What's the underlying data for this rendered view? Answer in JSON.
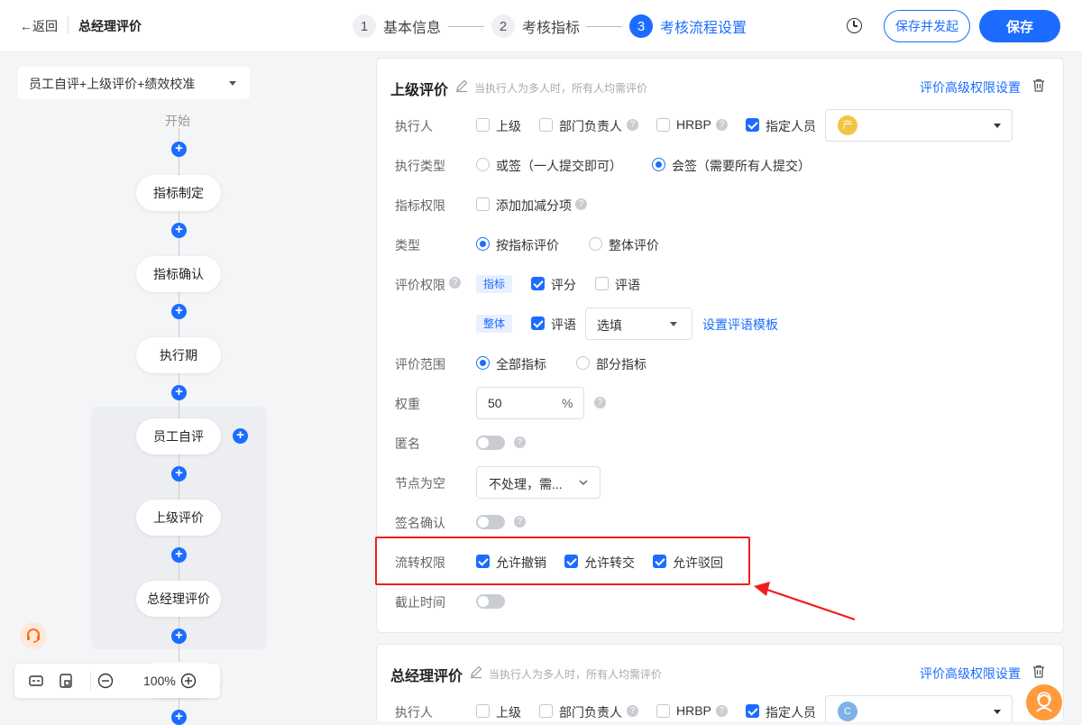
{
  "header": {
    "back_label": "←返回",
    "page_title": "总经理评价",
    "steps": [
      {
        "num": "1",
        "label": "基本信息"
      },
      {
        "num": "2",
        "label": "考核指标"
      },
      {
        "num": "3",
        "label": "考核流程设置"
      }
    ],
    "save_and_start_label": "保存并发起",
    "save_label": "保存"
  },
  "flow": {
    "template_select": "员工自评+上级评价+绩效校准",
    "start_label": "开始",
    "nodes": [
      "指标制定",
      "指标确认",
      "执行期",
      "员工自评",
      "上级评价",
      "总经理评价"
    ],
    "zoom_level": "100%"
  },
  "card1": {
    "title": "上级评价",
    "hint": "当执行人为多人时，所有人均需评价",
    "adv_settings": "评价高级权限设置",
    "executor": {
      "label": "执行人",
      "options": [
        "上级",
        "部门负责人",
        "HRBP",
        "指定人员"
      ],
      "avatar_text": "产"
    },
    "exec_type": {
      "label": "执行类型",
      "options": [
        "或签（一人提交即可）",
        "会签（需要所有人提交）"
      ]
    },
    "metric_perm": {
      "label": "指标权限",
      "option": "添加加减分项"
    },
    "type": {
      "label": "类型",
      "options": [
        "按指标评价",
        "整体评价"
      ]
    },
    "eval_perm": {
      "label": "评价权限",
      "tag_metric": "指标",
      "tag_overall": "整体",
      "score": "评分",
      "comment": "评语",
      "comment2": "评语",
      "comment_select": "选填",
      "template_link": "设置评语模板"
    },
    "scope": {
      "label": "评价范围",
      "options": [
        "全部指标",
        "部分指标"
      ]
    },
    "weight": {
      "label": "权重",
      "value": "50",
      "unit": "%"
    },
    "anonymous_label": "匿名",
    "empty_node": {
      "label": "节点为空",
      "value": "不处理，需..."
    },
    "sign_confirm_label": "签名确认",
    "flow_perm": {
      "label": "流转权限",
      "options": [
        "允许撤销",
        "允许转交",
        "允许驳回"
      ]
    },
    "deadline_label": "截止时间"
  },
  "card2": {
    "title": "总经理评价",
    "hint": "当执行人为多人时，所有人均需评价",
    "adv_settings": "评价高级权限设置",
    "executor": {
      "label": "执行人",
      "options": [
        "上级",
        "部门负责人",
        "HRBP",
        "指定人员"
      ],
      "avatar_text": "C"
    }
  },
  "colors": {
    "primary": "#1c6cff",
    "annotation_red": "#f01d1d",
    "avatar_yellow": "#f4c542",
    "avatar_blue": "#7fb2e5"
  }
}
